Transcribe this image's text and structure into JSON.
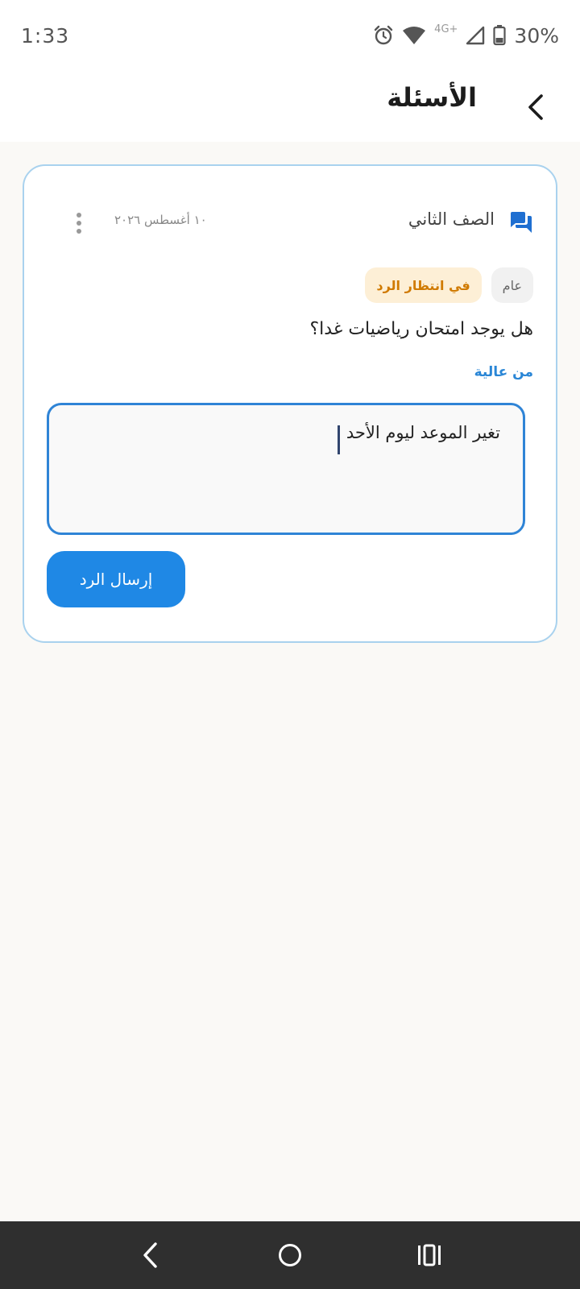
{
  "status": {
    "time": "1:33",
    "network_label": "4G+",
    "battery_percent": "30%",
    "icons": [
      "alarm-icon",
      "wifi-icon",
      "signal-icon",
      "battery-icon"
    ]
  },
  "header": {
    "title": "الأسئلة"
  },
  "question_card": {
    "class_name": "الصف الثاني",
    "date": "١٠ أغسطس ٢٠٢٦",
    "tags": {
      "category": "عام",
      "status": "في انتظار الرد"
    },
    "question_text": "هل يوجد امتحان رياضيات غدا؟",
    "asker": "من عالية",
    "reply_value": "تغير الموعد ليوم الأحد",
    "send_label": "إرسال الرد"
  },
  "colors": {
    "accent": "#1f88e5",
    "pending": "#d07a00",
    "card_border": "#a9d2ee"
  }
}
